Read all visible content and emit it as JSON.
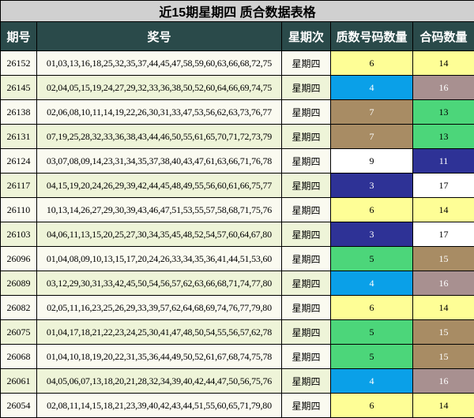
{
  "title": "近15期星期四 质合数据表格",
  "headers": [
    "期号",
    "奖号",
    "星期次",
    "质数号码数量",
    "合码数量"
  ],
  "colors": {
    "yellow": "#fefe96",
    "blue": "#0aa0e8",
    "brown": "#a88c64",
    "green": "#4cd67a",
    "white": "#ffffff",
    "navy": "#2e3296",
    "mauve": "#a89090"
  },
  "rows": [
    {
      "period": "26152",
      "numbers": "01,03,13,16,18,25,32,35,37,44,45,47,58,59,60,63,66,68,72,75",
      "day": "星期四",
      "prime": "6",
      "prime_color": "yellow",
      "composite": "14",
      "composite_color": "yellow"
    },
    {
      "period": "26145",
      "numbers": "02,04,05,15,19,24,27,29,32,33,36,38,50,52,60,64,66,69,74,75",
      "day": "星期四",
      "prime": "4",
      "prime_color": "blue",
      "composite": "16",
      "composite_color": "mauve"
    },
    {
      "period": "26138",
      "numbers": "02,06,08,10,11,14,19,22,26,30,31,33,47,53,56,62,63,73,76,77",
      "day": "星期四",
      "prime": "7",
      "prime_color": "brown",
      "composite": "13",
      "composite_color": "green"
    },
    {
      "period": "26131",
      "numbers": "07,19,25,28,32,33,36,38,43,44,46,50,55,61,65,70,71,72,73,79",
      "day": "星期四",
      "prime": "7",
      "prime_color": "brown",
      "composite": "13",
      "composite_color": "green"
    },
    {
      "period": "26124",
      "numbers": "03,07,08,09,14,23,31,34,35,37,38,40,43,47,61,63,66,71,76,78",
      "day": "星期四",
      "prime": "9",
      "prime_color": "white",
      "composite": "11",
      "composite_color": "navy"
    },
    {
      "period": "26117",
      "numbers": "04,15,19,20,24,26,29,39,42,44,45,48,49,55,56,60,61,66,75,77",
      "day": "星期四",
      "prime": "3",
      "prime_color": "navy",
      "composite": "17",
      "composite_color": "white"
    },
    {
      "period": "26110",
      "numbers": "10,13,14,26,27,29,30,39,43,46,47,51,53,55,57,58,68,71,75,76",
      "day": "星期四",
      "prime": "6",
      "prime_color": "yellow",
      "composite": "14",
      "composite_color": "yellow"
    },
    {
      "period": "26103",
      "numbers": "04,06,11,13,15,20,25,27,30,34,35,45,48,52,54,57,60,64,67,80",
      "day": "星期四",
      "prime": "3",
      "prime_color": "navy",
      "composite": "17",
      "composite_color": "white"
    },
    {
      "period": "26096",
      "numbers": "01,04,08,09,10,13,15,17,20,24,26,33,34,35,36,41,44,51,53,60",
      "day": "星期四",
      "prime": "5",
      "prime_color": "green",
      "composite": "15",
      "composite_color": "brown"
    },
    {
      "period": "26089",
      "numbers": "03,12,29,30,31,33,42,45,50,54,56,57,62,63,66,68,71,74,77,80",
      "day": "星期四",
      "prime": "4",
      "prime_color": "blue",
      "composite": "16",
      "composite_color": "mauve"
    },
    {
      "period": "26082",
      "numbers": "02,05,11,16,23,25,26,29,33,39,57,62,64,68,69,74,76,77,79,80",
      "day": "星期四",
      "prime": "6",
      "prime_color": "yellow",
      "composite": "14",
      "composite_color": "yellow"
    },
    {
      "period": "26075",
      "numbers": "01,04,17,18,21,22,23,24,25,30,41,47,48,50,54,55,56,57,62,78",
      "day": "星期四",
      "prime": "5",
      "prime_color": "green",
      "composite": "15",
      "composite_color": "brown"
    },
    {
      "period": "26068",
      "numbers": "01,04,10,18,19,20,22,31,35,36,44,49,50,52,61,67,68,74,75,78",
      "day": "星期四",
      "prime": "5",
      "prime_color": "green",
      "composite": "15",
      "composite_color": "brown"
    },
    {
      "period": "26061",
      "numbers": "04,05,06,07,13,18,20,21,28,32,34,39,40,42,44,47,50,56,75,76",
      "day": "星期四",
      "prime": "4",
      "prime_color": "blue",
      "composite": "16",
      "composite_color": "mauve"
    },
    {
      "period": "26054",
      "numbers": "02,08,11,14,15,18,21,23,39,40,42,43,44,51,55,60,65,71,79,80",
      "day": "星期四",
      "prime": "6",
      "prime_color": "yellow",
      "composite": "14",
      "composite_color": "yellow"
    }
  ]
}
